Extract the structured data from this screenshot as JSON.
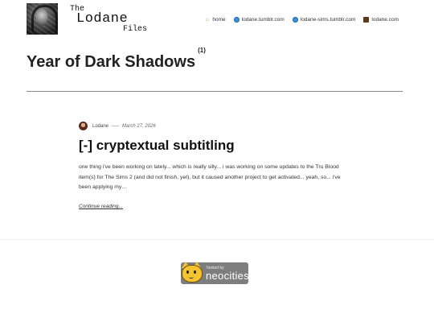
{
  "site": {
    "title_line1": "The",
    "title_line2": "Lodane",
    "title_line3": "Files"
  },
  "nav": [
    {
      "label": "home",
      "icon": "home-icon"
    },
    {
      "label": "lodane.tumblr.com",
      "icon": "globe-icon"
    },
    {
      "label": "lodane-sims.tumblr.com",
      "icon": "globe-icon"
    },
    {
      "label": "lodane.com",
      "icon": "briefcase-icon"
    }
  ],
  "page": {
    "title": "Year of Dark Shadows",
    "count": "(1)"
  },
  "post": {
    "author": "Lodane",
    "date": "March 27, 2026",
    "title": "[-] cryptextual subtitling",
    "excerpt": "one thing i've been working on lately... which is really silly... i was working on some updates to the Tru Blood item(s) for The Sims 2 (and did not finish, yet), but it caused another project to get activated... yeah, so... i've been applying my…",
    "more": "Continue reading..."
  },
  "footer": {
    "badge_small": "hosted by",
    "badge_big": "neocities"
  }
}
